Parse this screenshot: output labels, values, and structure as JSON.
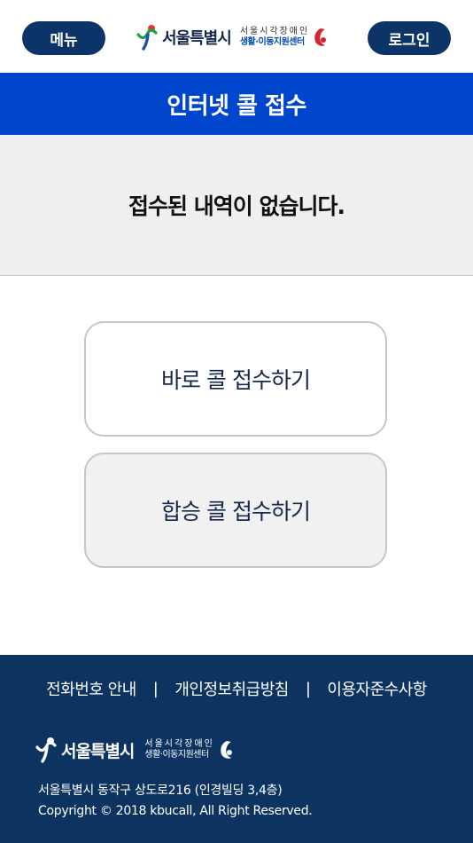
{
  "header": {
    "menu_label": "메뉴",
    "login_label": "로그인",
    "logo_city": "서울특별시",
    "logo_sub1": "서울시각장애인",
    "logo_sub2": "생활·이동지원센터"
  },
  "title": "인터넷 콜 접수",
  "empty_message": "접수된 내역이 없습니다.",
  "actions": {
    "quick_call": "바로 콜 접수하기",
    "share_call": "합승 콜 접수하기"
  },
  "footer": {
    "links": [
      "전화번호 안내",
      "개인정보취급방침",
      "이용자준수사항"
    ],
    "separator": "|",
    "logo_city": "서울특별시",
    "logo_sub1": "서울시각장애인",
    "logo_sub2": "생활·이동지원센터",
    "address": "서울특별시 동작구 상도로216 (인경빌딩 3,4층)",
    "copyright": "Copyright © 2018 kbucall, All Right Reserved."
  },
  "colors": {
    "primary_navy": "#0d3468",
    "title_blue": "#0046cc",
    "footer_navy": "#0d3461",
    "empty_bg": "#efefef"
  }
}
